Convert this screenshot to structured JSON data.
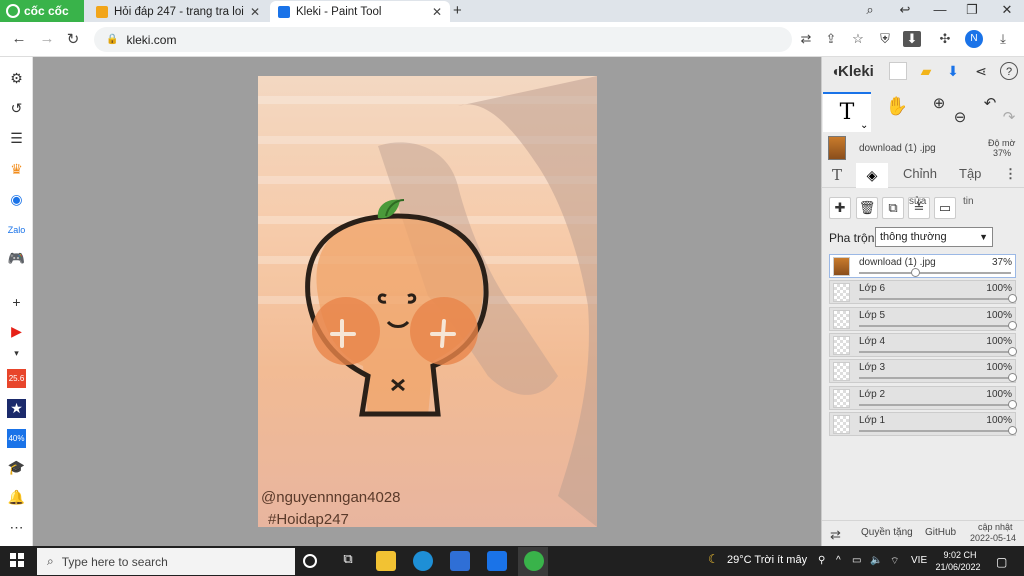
{
  "browser": {
    "brand": "cốc cốc",
    "tabs": [
      {
        "title": "Hỏi đáp 247 - trang tra loi",
        "active": false
      },
      {
        "title": "Kleki - Paint Tool",
        "active": true
      }
    ],
    "url": "kleki.com",
    "profile_initial": "N"
  },
  "canvas": {
    "watermark_line1": "@nguyennngan4028",
    "watermark_line2": "#Hoidap247"
  },
  "kleki": {
    "title": "Kleki",
    "active_layer_name": "download (1) .jpg",
    "opacity_label": "Độ mờ",
    "opacity_value": "37%",
    "subtabs": {
      "adjust": "Chỉnh",
      "file": "Tập"
    },
    "layer_btn_labels": {
      "sua": "sửa",
      "tin": "tin"
    },
    "blend_label": "Pha trộn",
    "blend_value": "thông thường",
    "layers": [
      {
        "name": "download (1) .jpg",
        "opacity": "37%",
        "fraction": 0.37,
        "active": true
      },
      {
        "name": "Lớp 6",
        "opacity": "100%",
        "fraction": 1.0,
        "active": false
      },
      {
        "name": "Lớp 5",
        "opacity": "100%",
        "fraction": 1.0,
        "active": false
      },
      {
        "name": "Lớp 4",
        "opacity": "100%",
        "fraction": 1.0,
        "active": false
      },
      {
        "name": "Lớp 3",
        "opacity": "100%",
        "fraction": 1.0,
        "active": false
      },
      {
        "name": "Lớp 2",
        "opacity": "100%",
        "fraction": 1.0,
        "active": false
      },
      {
        "name": "Lớp 1",
        "opacity": "100%",
        "fraction": 1.0,
        "active": false
      }
    ],
    "footer": {
      "privacy": "Quyền tặng",
      "github": "GitHub",
      "updated_label": "cập nhật",
      "updated_date": "2022-05-14"
    }
  },
  "taskbar": {
    "search_placeholder": "Type here to search",
    "weather": "29°C  Trời ít mây",
    "lang": "VIE",
    "time": "9:02 CH",
    "date": "21/06/2022"
  },
  "colors": {
    "accent": "#1a73e8",
    "brand_green": "#39b34a",
    "canvas_bg": "#9e9e9e"
  }
}
